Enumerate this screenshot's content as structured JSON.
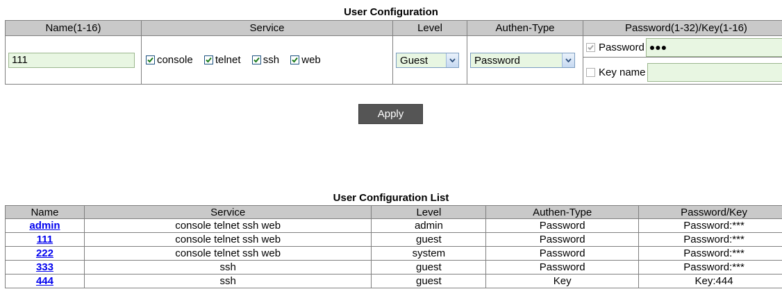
{
  "config": {
    "title": "User Configuration",
    "headers": {
      "name": "Name(1-16)",
      "service": "Service",
      "level": "Level",
      "authen": "Authen-Type",
      "password": "Password(1-32)/Key(1-16)"
    },
    "name_value": "111",
    "services": [
      {
        "label": "console",
        "checked": true
      },
      {
        "label": "telnet",
        "checked": true
      },
      {
        "label": "ssh",
        "checked": true
      },
      {
        "label": "web",
        "checked": true
      }
    ],
    "level_value": "Guest",
    "authen_value": "Password",
    "password_label": "Password",
    "password_value": "●●●",
    "key_label": "Key name",
    "key_value": ""
  },
  "apply_label": "Apply",
  "list": {
    "title": "User Configuration List",
    "headers": [
      "Name",
      "Service",
      "Level",
      "Authen-Type",
      "Password/Key"
    ],
    "rows": [
      [
        "admin",
        "console telnet ssh web",
        "admin",
        "Password",
        "Password:***"
      ],
      [
        "111",
        "console telnet ssh web",
        "guest",
        "Password",
        "Password:***"
      ],
      [
        "222",
        "console telnet ssh web",
        "system",
        "Password",
        "Password:***"
      ],
      [
        "333",
        "ssh",
        "guest",
        "Password",
        "Password:***"
      ],
      [
        "444",
        "ssh",
        "guest",
        "Key",
        "Key:444"
      ]
    ]
  },
  "colors": {
    "header_bg": "#c9c9c9",
    "input_bg": "#e8f6e2",
    "apply_bg": "#555555",
    "link": "#0000ee"
  }
}
